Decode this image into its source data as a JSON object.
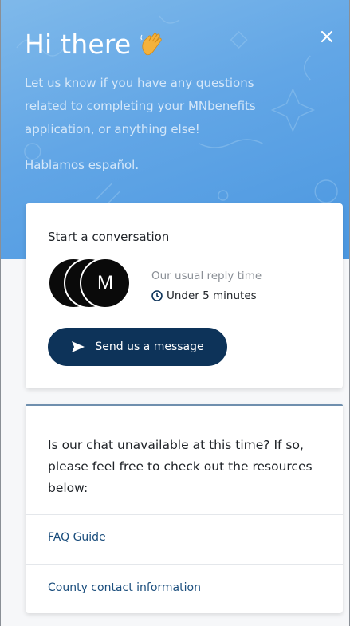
{
  "header": {
    "greeting": "Hi there",
    "wave_icon": "waving-hand-icon",
    "intro_text": "Let us know if you have any questions related to completing your MNbenefits application, or anything else!",
    "spanish_text": "Hablamos español.",
    "close_icon": "close-icon",
    "background_color": "#62a6e6"
  },
  "conversation": {
    "title": "Start a conversation",
    "avatar_initial": "M",
    "reply_label": "Our usual reply time",
    "reply_time": "Under 5 minutes",
    "clock_icon": "clock-icon",
    "button_label": "Send us a message",
    "send_icon": "send-icon",
    "button_color": "#0d3359"
  },
  "resources": {
    "message": "Is our chat unavailable at this time? If so, please feel free to check out the resources below:",
    "links": [
      {
        "label": "FAQ Guide"
      },
      {
        "label": "County contact information"
      }
    ],
    "link_color": "#1b4e7d"
  }
}
